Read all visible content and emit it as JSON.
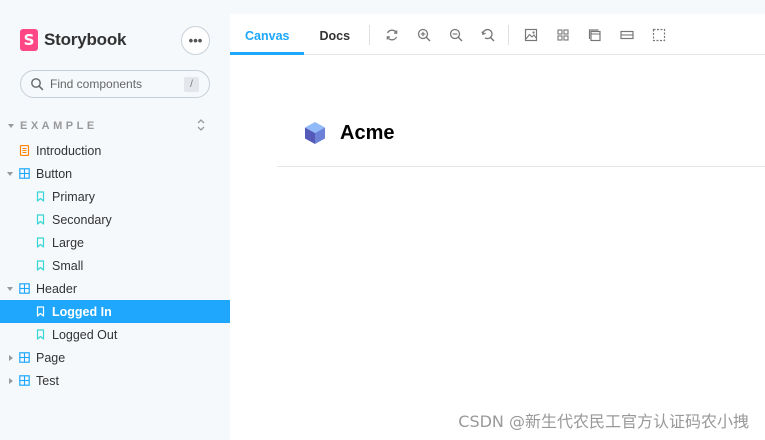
{
  "sidebar": {
    "brand": {
      "logo_letter": "S",
      "name": "Storybook"
    },
    "menu_label": "•••",
    "search": {
      "placeholder": "Find components",
      "shortcut": "/"
    },
    "section_label": "EXAMPLE",
    "tree": [
      {
        "label": "Introduction",
        "kind": "document",
        "depth": 0
      },
      {
        "label": "Button",
        "kind": "component",
        "depth": 0,
        "expanded": true
      },
      {
        "label": "Primary",
        "kind": "story",
        "depth": 1
      },
      {
        "label": "Secondary",
        "kind": "story",
        "depth": 1
      },
      {
        "label": "Large",
        "kind": "story",
        "depth": 1
      },
      {
        "label": "Small",
        "kind": "story",
        "depth": 1
      },
      {
        "label": "Header",
        "kind": "component",
        "depth": 0,
        "expanded": true
      },
      {
        "label": "Logged In",
        "kind": "story",
        "depth": 1,
        "selected": true
      },
      {
        "label": "Logged Out",
        "kind": "story",
        "depth": 1
      },
      {
        "label": "Page",
        "kind": "component",
        "depth": 0,
        "expanded": false
      },
      {
        "label": "Test",
        "kind": "component",
        "depth": 0,
        "expanded": false
      }
    ]
  },
  "toolbar": {
    "tabs": [
      {
        "label": "Canvas",
        "active": true
      },
      {
        "label": "Docs",
        "active": false
      }
    ],
    "tools": [
      "reload-icon",
      "zoom-in-icon",
      "zoom-out-icon",
      "zoom-reset-icon",
      "background-icon",
      "grid-icon",
      "viewport-icon",
      "measure-icon",
      "outline-icon"
    ]
  },
  "canvas": {
    "title": "Acme",
    "logo_icon": "acme-cube-icon"
  },
  "watermark": "CSDN @新生代农民工官方认证码农小拽",
  "colors": {
    "accent": "#1ea7fd",
    "brand": "#ff4785",
    "sidebar_bg": "#f6f9fc",
    "document_icon": "#ff8500",
    "component_icon": "#1ea7fd",
    "story_icon": "#37d5d3"
  }
}
